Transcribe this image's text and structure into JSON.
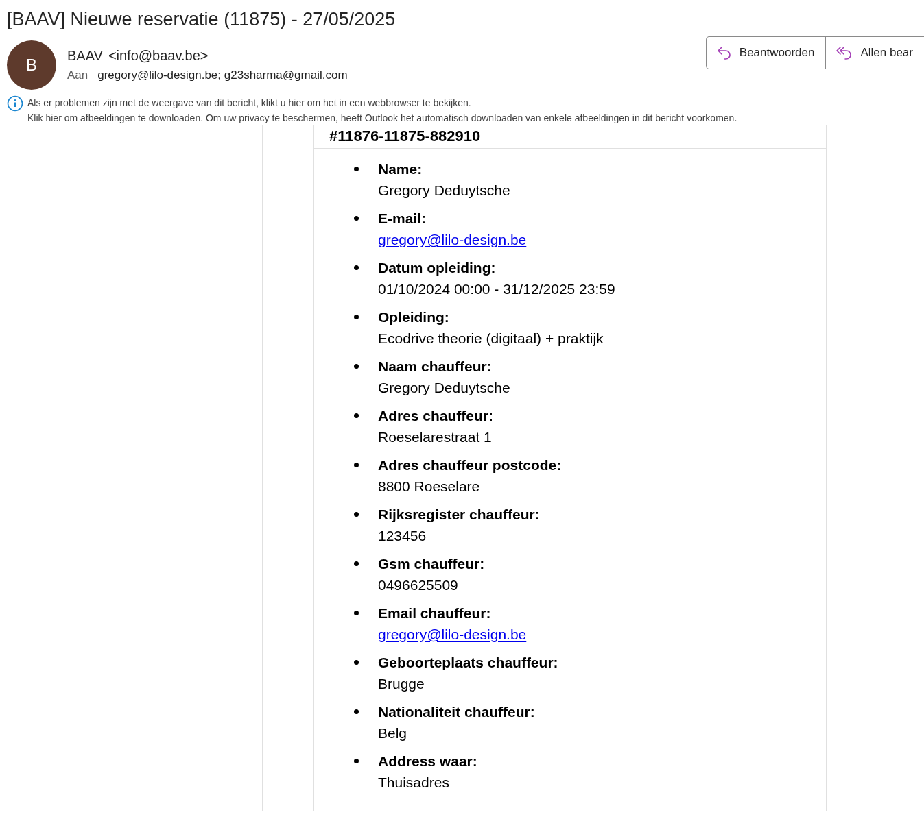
{
  "subject": "[BAAV] Nieuwe reservatie (11875) - 27/05/2025",
  "sender": {
    "initial": "B",
    "name": "BAAV",
    "address": "<info@baav.be>"
  },
  "recipients": {
    "label": "Aan",
    "value": "gregory@lilo-design.be; g23sharma@gmail.com"
  },
  "actions": [
    {
      "label": "Beantwoorden",
      "kind": "reply"
    },
    {
      "label": "Allen bear",
      "kind": "reply-all"
    }
  ],
  "notice": [
    "Als er problemen zijn met de weergave van dit bericht, klikt u hier om het in een webbrowser te bekijken.",
    "Klik hier om afbeeldingen te downloaden. Om uw privacy te beschermen, heeft Outlook het automatisch downloaden van enkele afbeeldingen in dit bericht voorkomen."
  ],
  "body": {
    "heading": "#11876-11875-882910",
    "fields": [
      {
        "label": "Name:",
        "value": "Gregory Deduytsche",
        "kind": "text"
      },
      {
        "label": "E-mail:",
        "value": "gregory@lilo-design.be",
        "kind": "link"
      },
      {
        "label": "Datum opleiding:",
        "value": "01/10/2024 00:00 - 31/12/2025 23:59",
        "kind": "text"
      },
      {
        "label": "Opleiding:",
        "value": "Ecodrive theorie (digitaal) + praktijk",
        "kind": "text"
      },
      {
        "label": "Naam chauffeur:",
        "value": "Gregory Deduytsche",
        "kind": "text"
      },
      {
        "label": "Adres chauffeur:",
        "value": "Roeselarestraat 1",
        "kind": "text"
      },
      {
        "label": "Adres chauffeur postcode:",
        "value": "8800 Roeselare",
        "kind": "text"
      },
      {
        "label": "Rijksregister chauffeur:",
        "value": "123456",
        "kind": "text"
      },
      {
        "label": "Gsm chauffeur:",
        "value": "0496625509",
        "kind": "text"
      },
      {
        "label": "Email chauffeur:",
        "value": "gregory@lilo-design.be",
        "kind": "link"
      },
      {
        "label": "Geboorteplaats chauffeur:",
        "value": "Brugge",
        "kind": "text"
      },
      {
        "label": "Nationaliteit chauffeur:",
        "value": "Belg",
        "kind": "text"
      },
      {
        "label": "Address waar:",
        "value": "Thuisadres",
        "kind": "text"
      }
    ]
  }
}
